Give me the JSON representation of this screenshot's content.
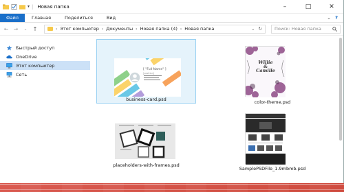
{
  "window": {
    "title": "Новая папка",
    "controls": {
      "minimize": "–",
      "maximize": "□",
      "close": "✕"
    }
  },
  "ribbon": {
    "tabs": [
      {
        "label": "Файл",
        "active": true
      },
      {
        "label": "Главная"
      },
      {
        "label": "Поделиться"
      },
      {
        "label": "Вид"
      }
    ],
    "expand": "⌄",
    "help": "?"
  },
  "address": {
    "back": "←",
    "forward": "→",
    "recent": "⌄",
    "up": "↑",
    "crumbs": [
      "Этот компьютер",
      "Документы",
      "Новая папка (4)",
      "Новая папка"
    ],
    "dropdown": "⌄",
    "refresh": "↻",
    "search_placeholder": "Поиск: Новая папка",
    "search_icon": "search-icon"
  },
  "sidebar": {
    "items": [
      {
        "label": "Быстрый доступ",
        "icon": "star-icon"
      },
      {
        "label": "OneDrive",
        "icon": "cloud-icon"
      },
      {
        "label": "Этот компьютер",
        "icon": "computer-icon",
        "selected": true
      },
      {
        "label": "Сеть",
        "icon": "network-icon"
      }
    ]
  },
  "files": [
    {
      "name": "business-card.psd",
      "selected": true,
      "card_name": "[ \"Full Name\" ]",
      "card_title": "[position]"
    },
    {
      "name": "color-theme.psd",
      "script": "Willie\n& \nCamille"
    },
    {
      "name": "placeholders-with-frames.psd"
    },
    {
      "name": "SamplePSDFile_1.9mbmb.psd"
    }
  ],
  "colors": {
    "accent": "#1a6fc9",
    "selection": "#cce1f7",
    "desktop": "#d9574a"
  }
}
